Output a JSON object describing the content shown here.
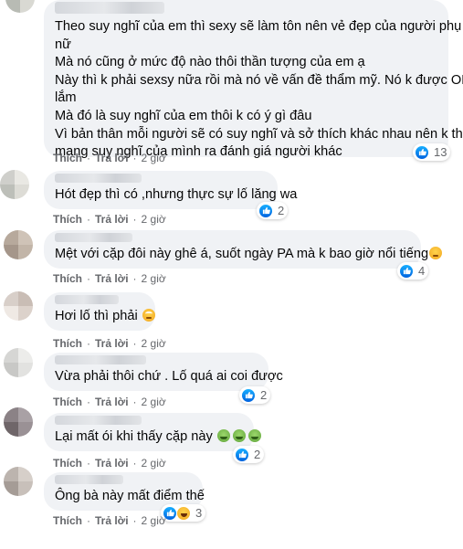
{
  "colors": {
    "bubble": "#f0f2f5",
    "meta_text": "#65676b",
    "like_blue": "#0062df"
  },
  "action_labels": {
    "like": "Thích",
    "reply": "Trả lời"
  },
  "comments": [
    {
      "lines": [
        "Theo suy nghĩ của em thì sexy sẽ làm tôn nên vẻ đẹp của người phụ",
        "nữ",
        "Mà nó cũng ở mức độ nào thôi thần tượng của em ạ",
        "Này thì k phải sexsy nữa rồi mà nó về vấn đề thẩm mỹ. Nó k được OK",
        "lắm",
        "Mà đó là suy nghĩ của em thôi k có ý gì đâu",
        "Vì bản thân mỗi người sẽ có suy nghĩ và sở thích khác nhau nên k thể",
        "mang suy nghĩ của mình ra đánh giá người khác"
      ],
      "reactions": [
        "like"
      ],
      "reaction_count": "13",
      "time": "2 giờ"
    },
    {
      "lines": [
        "Hót đẹp thì có ,nhưng thực sự lố lăng wa"
      ],
      "reactions": [
        "like"
      ],
      "reaction_count": "2",
      "time": "2 giờ"
    },
    {
      "lines": [
        "Mệt với cặp đôi này ghê á, suốt ngày PA mà k bao giờ nổi tiếng"
      ],
      "emoji_after": "shy-face-icon",
      "reactions": [
        "like"
      ],
      "reaction_count": "4",
      "time": "2 giờ"
    },
    {
      "lines": [
        "Hơi lố thì phải"
      ],
      "emoji_after": "eye-roll-face-icon",
      "reactions": [],
      "reaction_count": "",
      "time": "2 giờ"
    },
    {
      "lines": [
        "Vừa phải thôi chứ . Lố quá ai coi được"
      ],
      "reactions": [
        "like"
      ],
      "reaction_count": "2",
      "time": "2 giờ"
    },
    {
      "lines": [
        "Lại mất ói khi thấy cặp này"
      ],
      "emoji_after": "nauseated-face-icon",
      "reactions": [
        "like"
      ],
      "reaction_count": "2",
      "time": "2 giờ"
    },
    {
      "lines": [
        "Ông bà này mất điểm thế"
      ],
      "reactions": [
        "like",
        "haha"
      ],
      "reaction_count": "3",
      "time": "2 giờ"
    }
  ]
}
